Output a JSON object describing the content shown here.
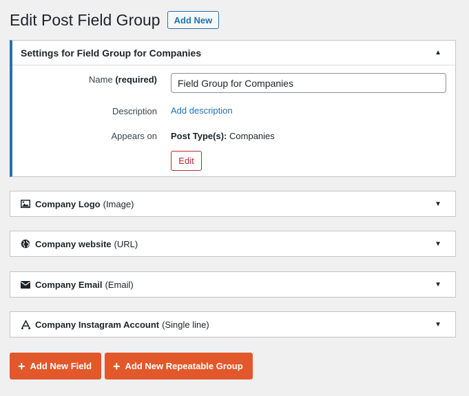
{
  "header": {
    "title": "Edit Post Field Group",
    "add_new_label": "Add New"
  },
  "settings": {
    "title": "Settings for Field Group for Companies",
    "name_label": "Name",
    "name_required": "(required)",
    "name_value": "Field Group for Companies",
    "description_label": "Description",
    "add_description_link": "Add description",
    "appears_on_label": "Appears on",
    "appears_on_key": "Post Type(s):",
    "appears_on_value": "Companies",
    "edit_label": "Edit"
  },
  "fields": [
    {
      "name": "Company Logo",
      "type": "(Image)",
      "icon": "image-icon"
    },
    {
      "name": "Company website",
      "type": "(URL)",
      "icon": "globe-icon"
    },
    {
      "name": "Company Email",
      "type": "(Email)",
      "icon": "envelope-icon"
    },
    {
      "name": "Company Instagram Account",
      "type": "(Single line)",
      "icon": "text-a-icon"
    }
  ],
  "actions": {
    "add_field_label": "Add New Field",
    "add_repeatable_label": "Add New Repeatable Group"
  },
  "colors": {
    "accent": "#2271b1",
    "action": "#e2582b",
    "danger": "#b32d2e"
  }
}
